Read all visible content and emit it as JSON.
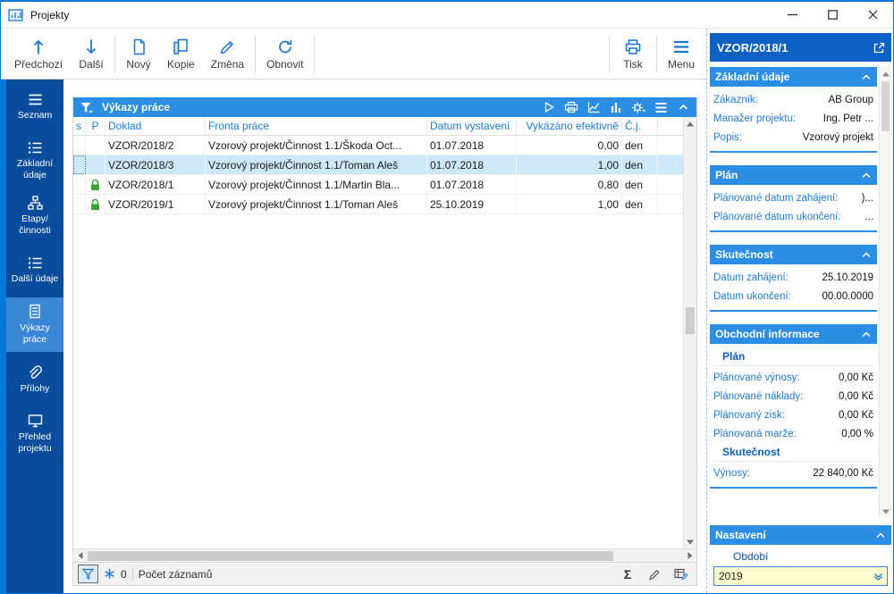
{
  "window": {
    "title": "Projekty"
  },
  "toolbar": {
    "prev": "Předchozí",
    "next": "Další",
    "new": "Nový",
    "copy": "Kopie",
    "change": "Změna",
    "refresh": "Obnovit",
    "print": "Tisk",
    "menu": "Menu"
  },
  "sidebar": {
    "items": [
      {
        "label": "Seznam"
      },
      {
        "label": "Základní údaje"
      },
      {
        "label": "Etapy/činnosti"
      },
      {
        "label": "Další údaje"
      },
      {
        "label": "Výkazy práce"
      },
      {
        "label": "Přílohy"
      },
      {
        "label": "Přehled projektu"
      }
    ]
  },
  "grid": {
    "title": "Výkazy práce",
    "columns": {
      "s": "s",
      "p": "P",
      "doklad": "Doklad",
      "fronta": "Fronta práce",
      "datum": "Datum vystavení",
      "vykazano": "Vykázáno efektivně",
      "cj": "Č.j."
    },
    "rows": [
      {
        "doklad": "VZOR/2018/2",
        "fronta": "Vzorový projekt/Činnost 1.1/Škoda Oct...",
        "datum": "01.07.2018",
        "vykazano": "0,00",
        "cj": "den",
        "locked": false,
        "selected": false
      },
      {
        "doklad": "VZOR/2018/3",
        "fronta": "Vzorový projekt/Činnost 1.1/Toman Aleš",
        "datum": "01.07.2018",
        "vykazano": "1,00",
        "cj": "den",
        "locked": false,
        "selected": true
      },
      {
        "doklad": "VZOR/2018/1",
        "fronta": "Vzorový projekt/Činnost 1.1/Martin Bla...",
        "datum": "01.07.2018",
        "vykazano": "0,80",
        "cj": "den",
        "locked": true,
        "selected": false
      },
      {
        "doklad": "VZOR/2019/1",
        "fronta": "Vzorový projekt/Činnost 1.1/Toman Aleš",
        "datum": "25.10.2019",
        "vykazano": "1,00",
        "cj": "den",
        "locked": true,
        "selected": false
      }
    ]
  },
  "statusbar": {
    "count_value": "0",
    "count_label": "Počet záznamů"
  },
  "detail": {
    "title": "VZOR/2018/1",
    "zakladni": {
      "header": "Základní údaje",
      "fields": [
        {
          "label": "Zákazník:",
          "value": "AB Group"
        },
        {
          "label": "Manažer projektu:",
          "value": "Ing. Petr ..."
        },
        {
          "label": "Popis:",
          "value": "Vzorový projekt"
        }
      ]
    },
    "plan": {
      "header": "Plán",
      "fields": [
        {
          "label": "Plánované datum zahájení:",
          "value": ")..."
        },
        {
          "label": "Plánované datum ukončení:",
          "value": "..."
        }
      ]
    },
    "skutecnost": {
      "header": "Skutečnost",
      "fields": [
        {
          "label": "Datum zahájení:",
          "value": "25.10.2019"
        },
        {
          "label": "Datum ukončení:",
          "value": "00.00.0000"
        }
      ]
    },
    "obchodni": {
      "header": "Obchodní informace",
      "sub_plan": "Plán",
      "plan_fields": [
        {
          "label": "Plánované výnosy:",
          "value": "0,00 Kč"
        },
        {
          "label": "Plánované náklady:",
          "value": "0,00 Kč"
        },
        {
          "label": "Plánovaný zisk:",
          "value": "0,00 Kč"
        },
        {
          "label": "Plánovaná marže:",
          "value": "0,00 %"
        }
      ],
      "sub_skutecnost": "Skutečnost",
      "skut_fields": [
        {
          "label": "Výnosy:",
          "value": "22 840,00 Kč"
        }
      ]
    },
    "nastaveni": {
      "header": "Nastavení",
      "obdobi_label": "Období",
      "obdobi_value": "2019"
    }
  }
}
